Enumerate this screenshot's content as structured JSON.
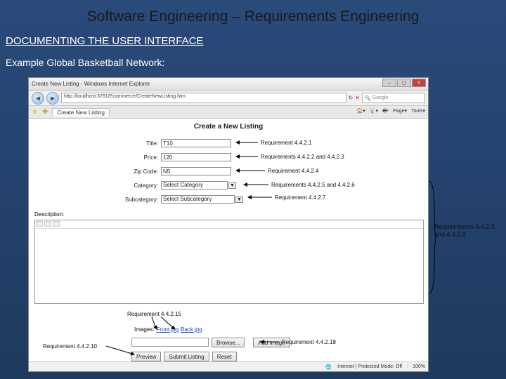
{
  "slide": {
    "title": "Software Engineering – Requirements Engineering",
    "section": "DOCUMENTING THE USER INTERFACE",
    "subtitle": "Example Global Basketball Network:"
  },
  "browser": {
    "window_title": "Create New Listing - Windows Internet Explorer",
    "url": "http://localhost:3781/Ecommerce/CreateNewListing.htm",
    "search_placeholder": "Google",
    "tab": "Create New Listing",
    "tool_home": "Home",
    "tool_feeds": "Feeds",
    "tool_print": "Print",
    "tool_page": "Page",
    "tool_tools": "Tools",
    "status_mode": "Internet | Protected Mode: Off",
    "status_zoom": "100%"
  },
  "page": {
    "heading": "Create a New Listing",
    "fields": {
      "title_label": "Title:",
      "title_value": "T10",
      "price_label": "Price:",
      "price_value": "120",
      "zip_label": "Zip Code:",
      "zip_value": "N5",
      "category_label": "Category:",
      "category_value": "Select Category",
      "subcategory_label": "Subcategory:",
      "subcategory_value": "Select Subcategory",
      "description_label": "Description:"
    },
    "images": {
      "label": "Images:",
      "front_link": "Front.jpg",
      "back_link": "Back.jpg"
    },
    "buttons": {
      "browse": "Browse...",
      "add_image": "Add image",
      "preview": "Preview",
      "submit": "Submit Listing",
      "reset": "Reset"
    }
  },
  "annotations": {
    "req_title": "Requirement 4.4.2.1",
    "req_price": "Requirements 4.4.2.2 and 4.4.2.3",
    "req_zip": "Requirement 4.4.2.4",
    "req_category": "Requirements 4.4.2.5 and 4.4.2.6",
    "req_subcategory": "Requirement 4.4.2.7",
    "req_images_label": "Requirement 4.4.2.15",
    "req_preview": "Requirement 4.4.2.10",
    "req_addimage": "Requirement 4.4.2.18",
    "side_line1": "Requirements 4.4.2.8",
    "side_line2": "and 4.4.2.9"
  }
}
